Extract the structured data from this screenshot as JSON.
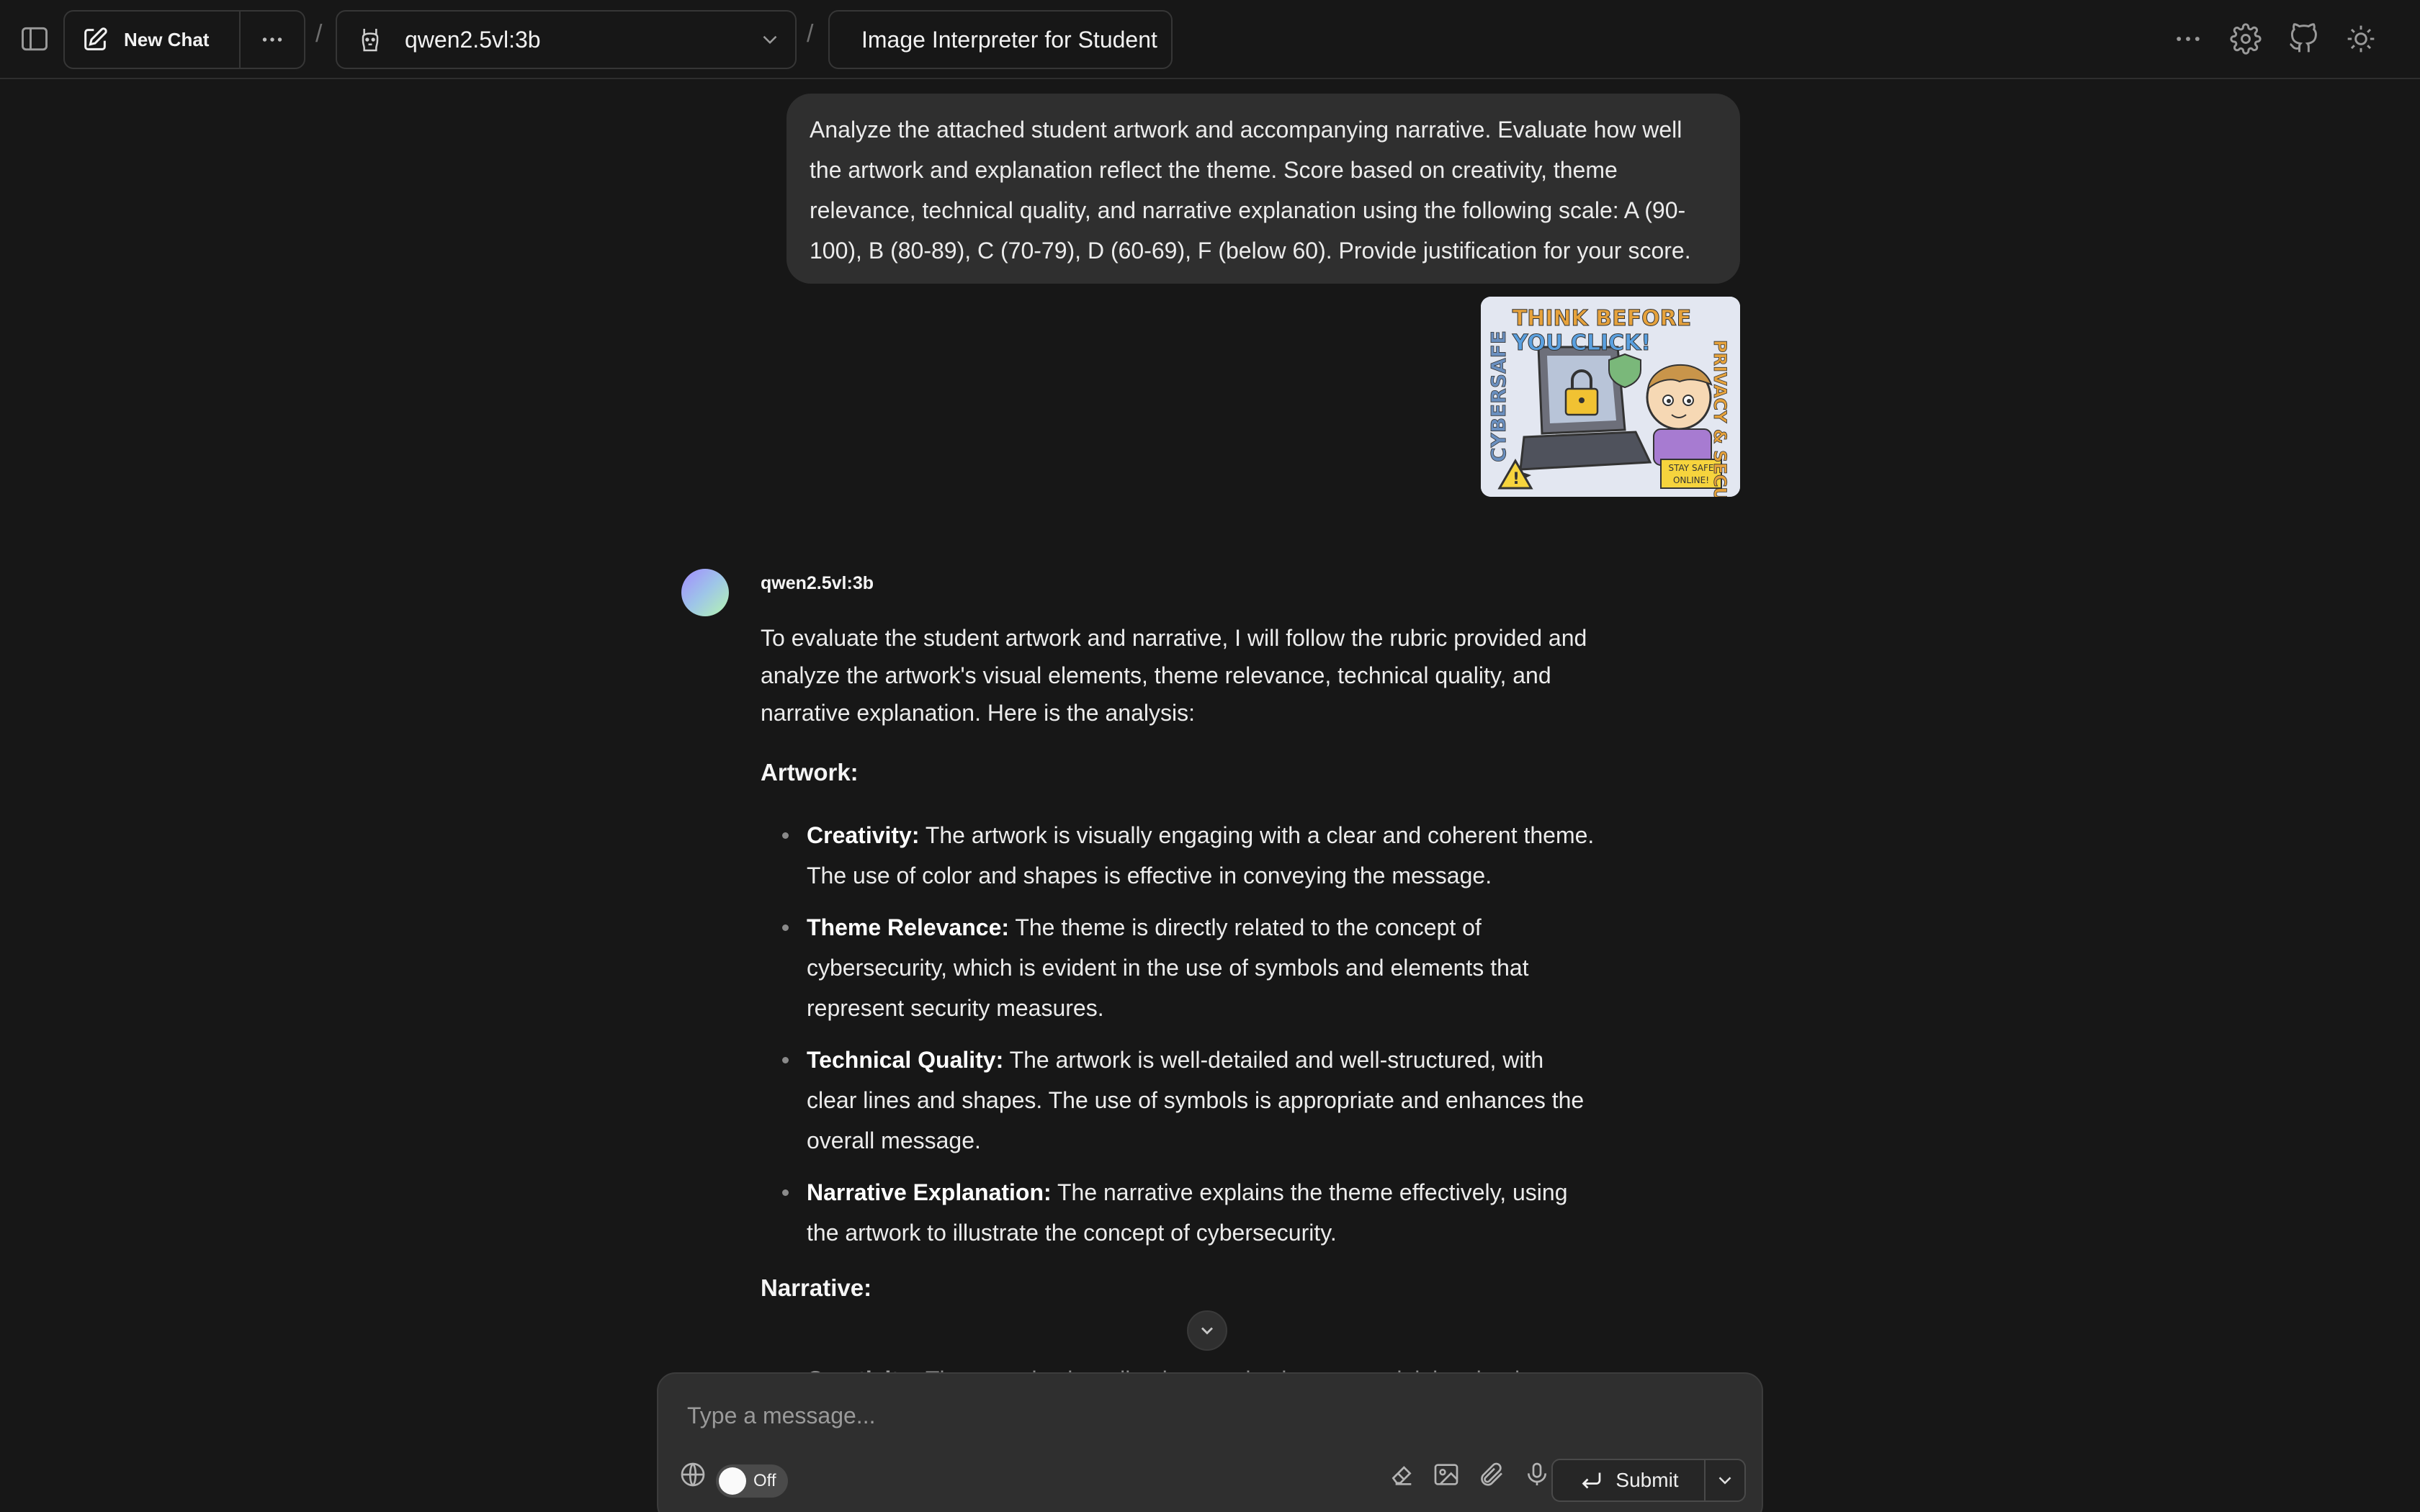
{
  "header": {
    "new_chat_label": "New Chat",
    "breadcrumb_separator": "/",
    "model": "qwen2.5vl:3b",
    "chat_title": "Image Interpreter for Student"
  },
  "user_message": {
    "text": "Analyze the attached student artwork and accompanying narrative. Evaluate how well the artwork and explanation reflect the theme. Score based on creativity, theme relevance, technical quality, and narrative explanation using the following scale: A (90-100), B (80-89), C (70-79), D (60-69), F (below 60). Provide justification for your score."
  },
  "attachment": {
    "artwork_text": {
      "line1": "THINK BEFORE",
      "line2": "YOU CLICK!",
      "left": "CYBERSAFE",
      "right": "PRIVACY & SECURITY",
      "sign": "STAY SAFE ONLINE!"
    }
  },
  "assistant": {
    "model_name": "qwen2.5vl:3b",
    "intro": "To evaluate the student artwork and narrative, I will follow the rubric provided and analyze the artwork's visual elements, theme relevance, technical quality, and narrative explanation. Here is the analysis:",
    "section1_title": "Artwork:",
    "items": [
      {
        "label": "Creativity:",
        "text": " The artwork is visually engaging with a clear and coherent theme. The use of color and shapes is effective in conveying the message."
      },
      {
        "label": "Theme Relevance:",
        "text": " The theme is directly related to the concept of cybersecurity, which is evident in the use of symbols and elements that represent security measures."
      },
      {
        "label": "Technical Quality:",
        "text": " The artwork is well-detailed and well-structured, with clear lines and shapes. The use of symbols is appropriate and enhances the overall message."
      },
      {
        "label": "Narrative Explanation:",
        "text": " The narrative explains the theme effectively, using the artwork to illustrate the concept of cybersecurity."
      }
    ],
    "section2_title": "Narrative:",
    "partial_label": "Creativity:",
    "partial_text": " The narrative is well-written and coherent, explaining the theme"
  },
  "composer": {
    "placeholder": "Type a message...",
    "toggle_label": "Off",
    "submit_label": "Submit"
  }
}
